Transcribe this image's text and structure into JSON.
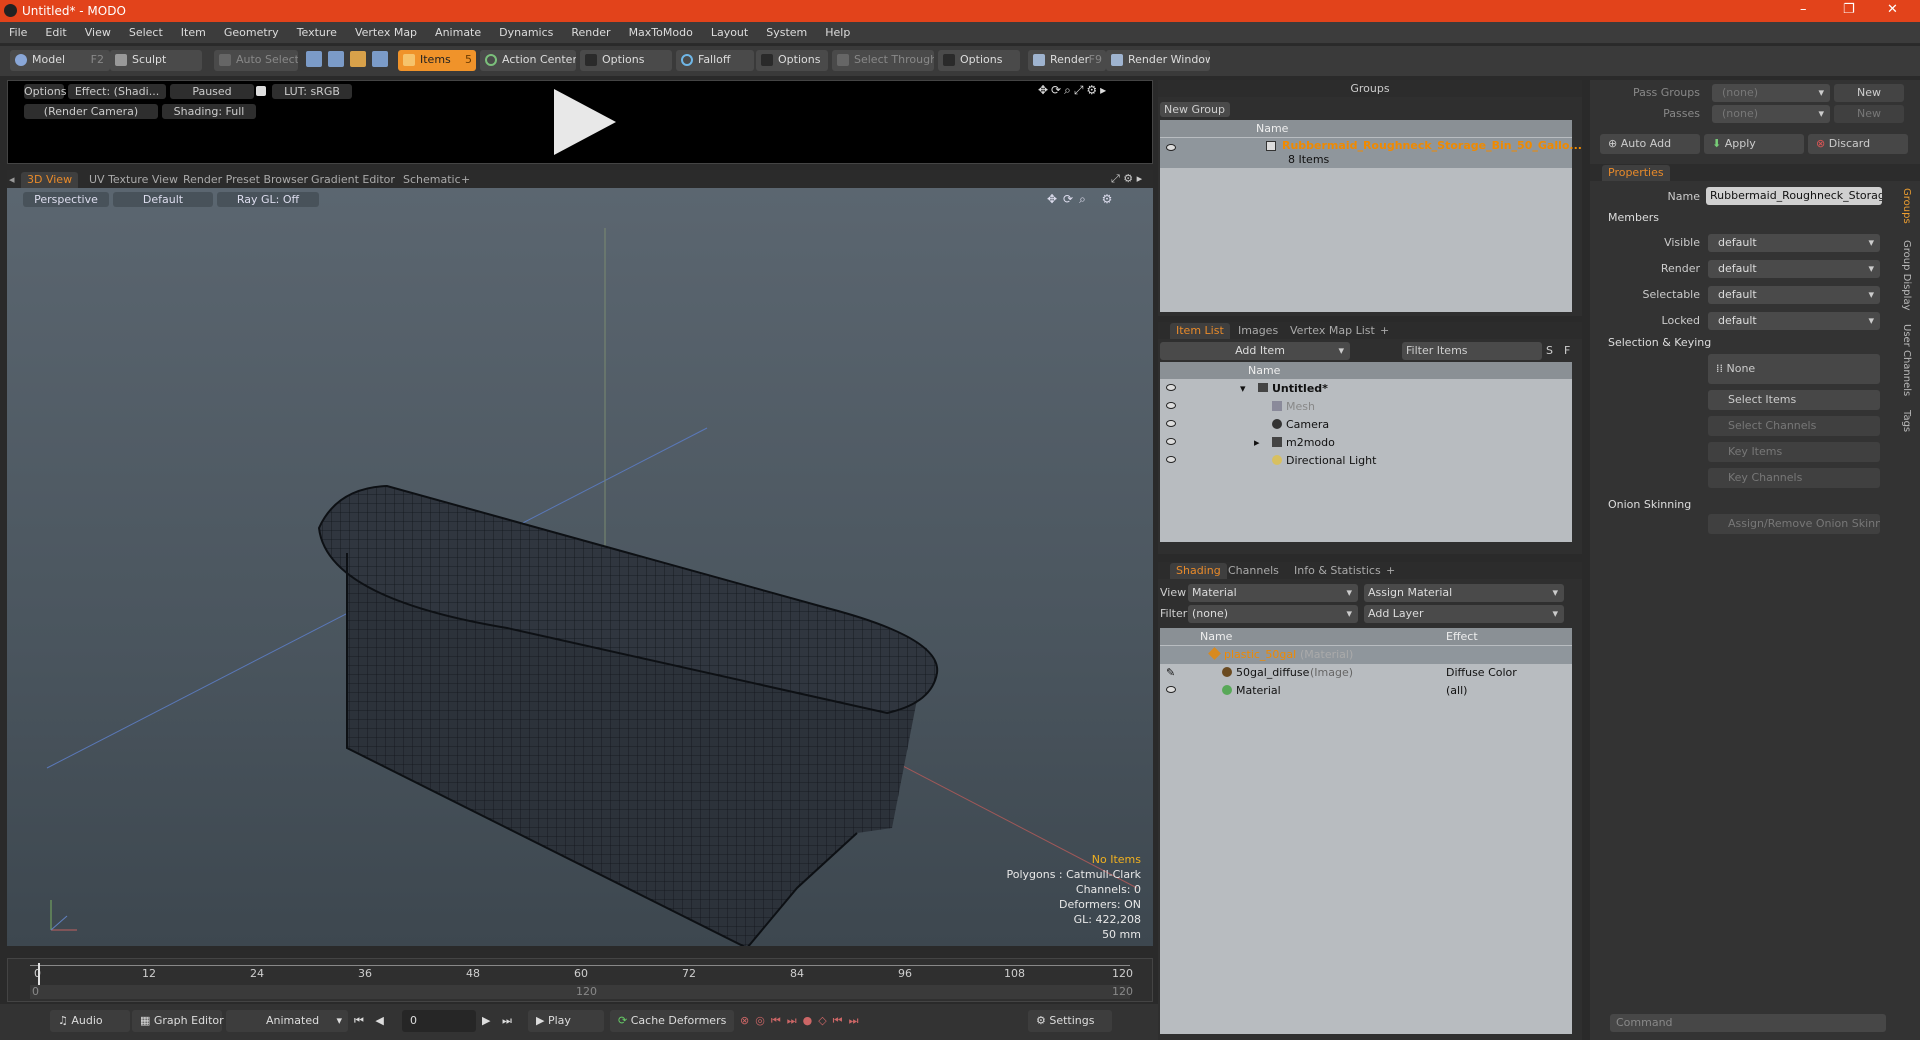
{
  "window": {
    "title": "Untitled* - MODO",
    "minimize": "–",
    "maximize": "❐",
    "close": "✕"
  },
  "menu": [
    "File",
    "Edit",
    "View",
    "Select",
    "Item",
    "Geometry",
    "Texture",
    "Vertex Map",
    "Animate",
    "Dynamics",
    "Render",
    "MaxToModo",
    "Layout",
    "System",
    "Help"
  ],
  "toolbar": {
    "model": "Model",
    "model_key": "F2",
    "sculpt": "Sculpt",
    "auto_select": "Auto Select",
    "items": "Items",
    "items_key": "5",
    "action_center": "Action Center",
    "options1": "Options",
    "falloff": "Falloff",
    "options2": "Options",
    "select_through": "Select Through",
    "options3": "Options",
    "render": "Render",
    "render_key": "F9",
    "render_window": "Render Window"
  },
  "preview": {
    "options": "Options",
    "effect": "Effect: (Shadi...",
    "paused": "Paused",
    "lut": "LUT: sRGB",
    "camera": "(Render Camera)",
    "shading": "Shading: Full"
  },
  "viewport_tabs": [
    "3D View",
    "UV Texture View",
    "Render Preset Browser",
    "Gradient Editor",
    "Schematic",
    "+"
  ],
  "viewport": {
    "projection": "Perspective",
    "style": "Default",
    "raygl": "Ray GL: Off",
    "stats": {
      "selection": "No Items",
      "polygons": "Polygons : Catmull-Clark",
      "channels": "Channels: 0",
      "deformers": "Deformers: ON",
      "gl": "GL: 422,208",
      "scale": "50 mm"
    }
  },
  "timeline": {
    "ticks": [
      "0",
      "12",
      "24",
      "36",
      "48",
      "60",
      "72",
      "84",
      "96",
      "108",
      "120"
    ],
    "sub_ticks": [
      "0",
      "120",
      "120"
    ]
  },
  "bottom": {
    "audio": "Audio",
    "graph_editor": "Graph Editor",
    "animated": "Animated",
    "frame": "0",
    "play": "Play",
    "cache": "Cache Deformers",
    "settings": "Settings"
  },
  "groups": {
    "title": "Groups",
    "new_group": "New Group",
    "col_name": "Name",
    "item_name": "Rubbermaid_Roughneck_Storage_Bin_50_Gallo...",
    "item_count": "8 Items"
  },
  "item_list": {
    "tabs": [
      "Item List",
      "Images",
      "Vertex Map List",
      "+"
    ],
    "add_item": "Add Item",
    "filter": "Filter Items",
    "f": "F",
    "s": "S",
    "col_name": "Name",
    "rows": [
      {
        "name": "Untitled*",
        "kind": "scene"
      },
      {
        "name": "Mesh",
        "kind": "mesh"
      },
      {
        "name": "Camera",
        "kind": "camera"
      },
      {
        "name": "m2modo",
        "kind": "group"
      },
      {
        "name": "Directional Light",
        "kind": "light"
      }
    ]
  },
  "shading": {
    "tabs": [
      "Shading",
      "Channels",
      "Info & Statistics",
      "+"
    ],
    "view_label": "View",
    "view_value": "Material",
    "assign": "Assign Material",
    "filter_label": "Filter",
    "filter_value": "(none)",
    "add_layer": "Add Layer",
    "col_name": "Name",
    "col_effect": "Effect",
    "rows": [
      {
        "name": "plastic_50gal",
        "tag": "(Material)",
        "effect": ""
      },
      {
        "name": "50gal_diffuse",
        "tag": "(Image)",
        "effect": "Diffuse Color"
      },
      {
        "name": "Material",
        "tag": "",
        "effect": "(all)"
      }
    ]
  },
  "right": {
    "pass_groups": "Pass Groups",
    "passes": "Passes",
    "none1": "(none)",
    "none2": "(none)",
    "new1": "New",
    "new2": "New",
    "auto_add": "Auto Add",
    "apply": "Apply",
    "discard": "Discard",
    "properties": "Properties",
    "name_label": "Name",
    "name_value": "Rubbermaid_Roughneck_Storage_B",
    "members": "Members",
    "visible": "Visible",
    "render": "Render",
    "selectable": "Selectable",
    "locked": "Locked",
    "default": "default",
    "sel_keying": "Selection & Keying",
    "none_btn": "None",
    "select_items": "Select Items",
    "select_channels": "Select Channels",
    "key_items": "Key Items",
    "key_channels": "Key Channels",
    "onion": "Onion Skinning",
    "assign_onion": "Assign/Remove Onion Skinning",
    "command": "Command",
    "side_tabs": [
      "Groups",
      "Group Display",
      "User Channels",
      "Tags"
    ]
  }
}
